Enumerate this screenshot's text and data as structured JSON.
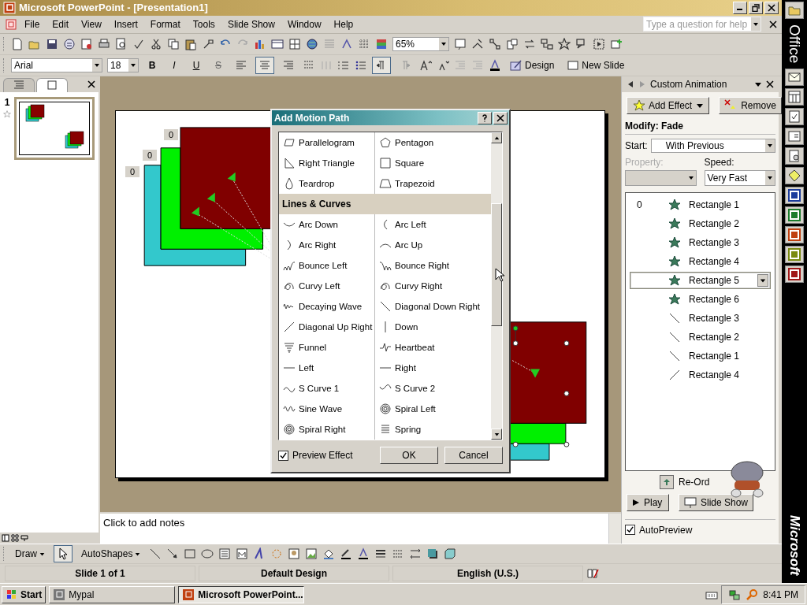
{
  "window": {
    "title": "Microsoft PowerPoint - [Presentation1]"
  },
  "menu": [
    "File",
    "Edit",
    "View",
    "Insert",
    "Format",
    "Tools",
    "Slide Show",
    "Window",
    "Help"
  ],
  "help_box": {
    "placeholder": "Type a question for help"
  },
  "standard_toolbar": {
    "zoom": "65%"
  },
  "formatting_toolbar": {
    "font": "Arial",
    "size": "18",
    "style_buttons": [
      "B",
      "I",
      "U",
      "S"
    ],
    "alignment_buttons": [
      {
        "kind": "left",
        "selected": false
      },
      {
        "kind": "center",
        "selected": true
      },
      {
        "kind": "right",
        "selected": false
      }
    ],
    "direction_buttons": [
      {
        "kind": "ltr",
        "selected": true
      },
      {
        "kind": "rtl",
        "selected": false
      }
    ],
    "design": "Design",
    "new_slide": "New Slide"
  },
  "outline_pane": {
    "tabs": [
      {
        "kind": "outline",
        "selected": false
      },
      {
        "kind": "slides",
        "selected": true
      }
    ],
    "slides": [
      {
        "number": "1",
        "selected": true
      }
    ]
  },
  "slide": {
    "animation_tags": [
      "0",
      "0",
      "0"
    ]
  },
  "notes": {
    "prompt": "Click to add notes"
  },
  "dialog": {
    "title": "Add Motion Path",
    "sections": [
      {
        "items": [
          {
            "kind": "parallelogram",
            "label": "Parallelogram"
          },
          {
            "kind": "pentagon",
            "label": "Pentagon"
          },
          {
            "kind": "right-triangle",
            "label": "Right Triangle"
          },
          {
            "kind": "square",
            "label": "Square"
          },
          {
            "kind": "teardrop",
            "label": "Teardrop"
          },
          {
            "kind": "trapezoid",
            "label": "Trapezoid"
          }
        ]
      },
      {
        "heading": "Lines & Curves",
        "items": [
          {
            "kind": "arc-down",
            "label": "Arc Down"
          },
          {
            "kind": "arc-left",
            "label": "Arc Left"
          },
          {
            "kind": "arc-right",
            "label": "Arc Right"
          },
          {
            "kind": "arc-up",
            "label": "Arc Up"
          },
          {
            "kind": "bounce-left",
            "label": "Bounce Left"
          },
          {
            "kind": "bounce-right",
            "label": "Bounce Right"
          },
          {
            "kind": "curvy",
            "label": "Curvy Left"
          },
          {
            "kind": "curvy",
            "label": "Curvy Right"
          },
          {
            "kind": "decaying-wave",
            "label": "Decaying Wave"
          },
          {
            "kind": "diagonal-down",
            "label": "Diagonal Down Right"
          },
          {
            "kind": "diagonal-up",
            "label": "Diagonal Up Right"
          },
          {
            "kind": "vertical-line",
            "label": "Down"
          },
          {
            "kind": "funnel",
            "label": "Funnel"
          },
          {
            "kind": "heartbeat",
            "label": "Heartbeat"
          },
          {
            "kind": "horizontal-line",
            "label": "Left"
          },
          {
            "kind": "horizontal-line",
            "label": "Right"
          },
          {
            "kind": "s-curve-1",
            "label": "S Curve 1"
          },
          {
            "kind": "s-curve-2",
            "label": "S Curve 2"
          },
          {
            "kind": "sine-wave",
            "label": "Sine Wave"
          },
          {
            "kind": "spiral",
            "label": "Spiral Left"
          },
          {
            "kind": "spiral",
            "label": "Spiral Right"
          },
          {
            "kind": "spring",
            "label": "Spring"
          }
        ]
      }
    ],
    "preview_effect": {
      "label": "Preview Effect",
      "checked": true
    },
    "buttons": [
      "OK",
      "Cancel"
    ]
  },
  "task_pane": {
    "title": "Custom Animation",
    "add_effect": "Add Effect",
    "remove": "Remove",
    "modify": "Modify: Fade",
    "start": {
      "label": "Start:",
      "value": "With Previous"
    },
    "property": {
      "label": "Property:",
      "disabled": true
    },
    "speed": {
      "label": "Speed:",
      "value": "Very Fast"
    },
    "effects": [
      {
        "index": "0",
        "kind": "star",
        "name": "Rectangle 1",
        "selected": false
      },
      {
        "kind": "star",
        "name": "Rectangle 2",
        "selected": false
      },
      {
        "kind": "star",
        "name": "Rectangle 3",
        "selected": false
      },
      {
        "kind": "star",
        "name": "Rectangle 4",
        "selected": false
      },
      {
        "kind": "star",
        "name": "Rectangle 5",
        "selected": true
      },
      {
        "kind": "star",
        "name": "Rectangle 6",
        "selected": false
      },
      {
        "kind": "path-down",
        "name": "Rectangle 3",
        "selected": false
      },
      {
        "kind": "path-down",
        "name": "Rectangle 2",
        "selected": false
      },
      {
        "kind": "path-down",
        "name": "Rectangle 1",
        "selected": false
      },
      {
        "kind": "path-up",
        "name": "Rectangle 4",
        "selected": false
      }
    ],
    "reorder": "Re-Ord",
    "play": "Play",
    "slide_show": "Slide Show",
    "autopreview": {
      "label": "AutoPreview",
      "checked": true
    }
  },
  "office_bar": {
    "top_label": "Office",
    "bottom_label": "Microsoft"
  },
  "drawing_toolbar": {
    "draw": "Draw",
    "autoshapes": "AutoShapes"
  },
  "status_bar": [
    "Slide 1 of 1",
    "Default Design",
    "English (U.S.)"
  ],
  "taskbar": {
    "start": "Start",
    "tasks": [
      {
        "label": "Mypal",
        "selected": false
      },
      {
        "label": "Microsoft PowerPoint...",
        "selected": true
      }
    ],
    "clock": "8:41 PM"
  }
}
